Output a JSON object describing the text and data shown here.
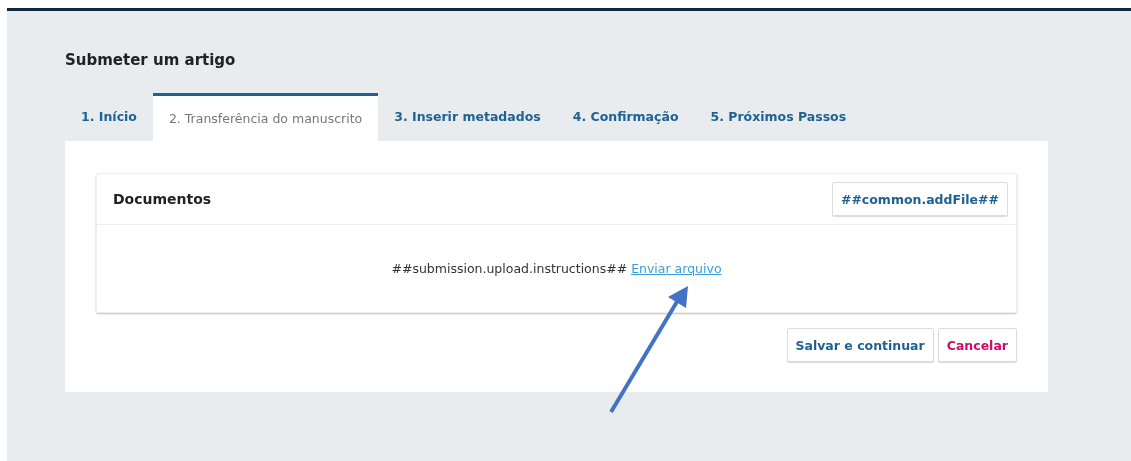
{
  "page": {
    "title": "Submeter um artigo"
  },
  "tabs": [
    {
      "label": "1. Início",
      "selected": false
    },
    {
      "label": "2. Transferência do manuscrito",
      "selected": true
    },
    {
      "label": "3. Inserir metadados",
      "selected": false
    },
    {
      "label": "4. Confirmação",
      "selected": false
    },
    {
      "label": "5. Próximos Passos",
      "selected": false
    }
  ],
  "documents": {
    "title": "Documentos",
    "add_button": "##common.addFile##",
    "instructions": "##submission.upload.instructions##",
    "upload_link": "Enviar arquivo"
  },
  "buttons": [
    {
      "label": "Salvar e continuar",
      "kind": "primary"
    },
    {
      "label": "Cancelar",
      "kind": "cancel"
    }
  ]
}
